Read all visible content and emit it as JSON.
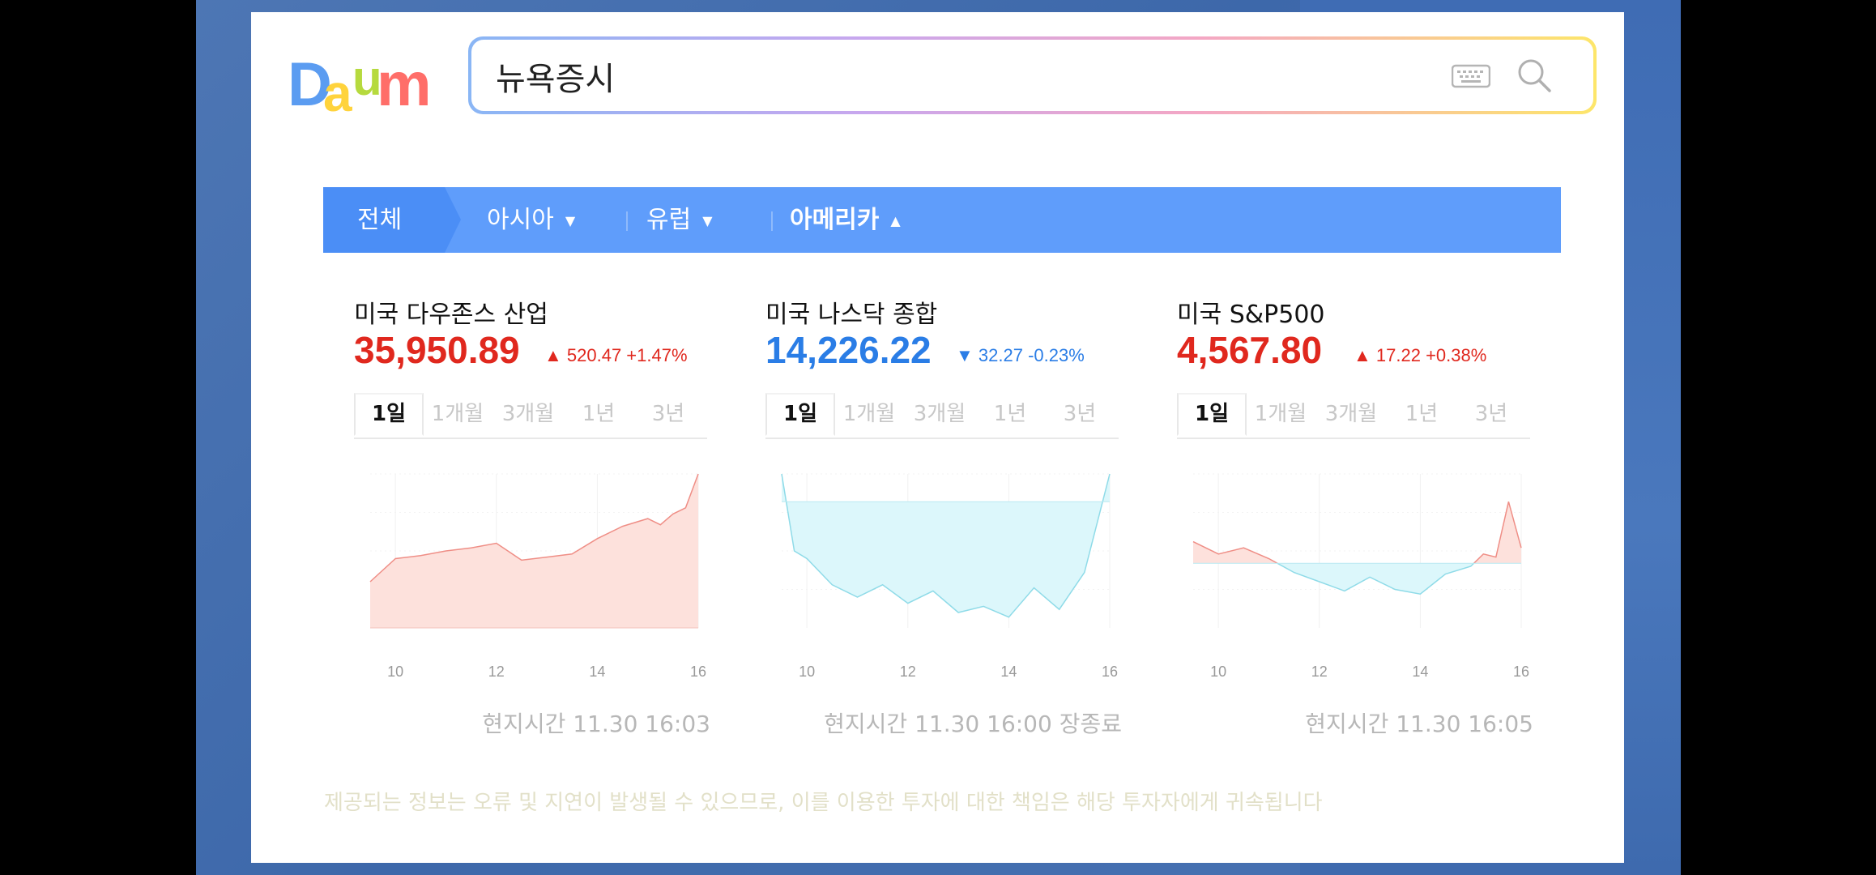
{
  "logo": {
    "text": "Daum"
  },
  "search": {
    "query": "뉴욕증시"
  },
  "tabs": {
    "all": "전체",
    "asia": "아시아",
    "europe": "유럽",
    "america": "아메리카"
  },
  "markets": [
    {
      "name": "미국 다우존스 산업",
      "price": "35,950.89",
      "direction": "up",
      "change": "520.47 +1.47%",
      "timestamp": "현지시간 11.30 16:03"
    },
    {
      "name": "미국 나스닥 종합",
      "price": "14,226.22",
      "direction": "down",
      "change": "32.27 -0.23%",
      "timestamp": "현지시간 11.30 16:00 장종료"
    },
    {
      "name": "미국 S&P500",
      "price": "4,567.80",
      "direction": "up",
      "change": "17.22 +0.38%",
      "timestamp": "현지시간 11.30 16:05"
    }
  ],
  "period_tabs": [
    "1일",
    "1개월",
    "3개월",
    "1년",
    "3년"
  ],
  "chart_data": [
    {
      "type": "area",
      "x_ticks": [
        "10",
        "12",
        "14",
        "16"
      ],
      "x": [
        9.5,
        10,
        10.5,
        11,
        11.5,
        12,
        12.5,
        13,
        13.5,
        14,
        14.5,
        15,
        15.25,
        15.5,
        15.75,
        16
      ],
      "y": [
        0.3,
        0.45,
        0.47,
        0.5,
        0.52,
        0.55,
        0.44,
        0.46,
        0.48,
        0.58,
        0.66,
        0.71,
        0.67,
        0.74,
        0.78,
        1.0
      ],
      "baseline": 0.0
    },
    {
      "type": "area",
      "x_ticks": [
        "10",
        "12",
        "14",
        "16"
      ],
      "x": [
        9.5,
        9.75,
        10,
        10.5,
        11,
        11.5,
        12,
        12.5,
        13,
        13.5,
        14,
        14.5,
        15,
        15.5,
        16
      ],
      "y": [
        1.0,
        0.5,
        0.45,
        0.28,
        0.2,
        0.28,
        0.16,
        0.24,
        0.1,
        0.14,
        0.07,
        0.26,
        0.12,
        0.36,
        1.0
      ],
      "baseline": 0.82
    },
    {
      "type": "area",
      "x_ticks": [
        "10",
        "12",
        "14",
        "16"
      ],
      "x": [
        9.5,
        10,
        10.5,
        11,
        11.5,
        12,
        12.5,
        13,
        13.5,
        14,
        14.5,
        15,
        15.25,
        15.5,
        15.75,
        16
      ],
      "y": [
        0.56,
        0.48,
        0.52,
        0.45,
        0.36,
        0.3,
        0.24,
        0.33,
        0.25,
        0.22,
        0.35,
        0.4,
        0.48,
        0.46,
        0.82,
        0.52
      ],
      "baseline": 0.42
    }
  ],
  "disclaimer": "제공되는 정보는 오류 및 지연이 발생될 수 있으므로, 이를 이용한 투자에 대한 책임은 해당 투자자에게 귀속됩니다"
}
